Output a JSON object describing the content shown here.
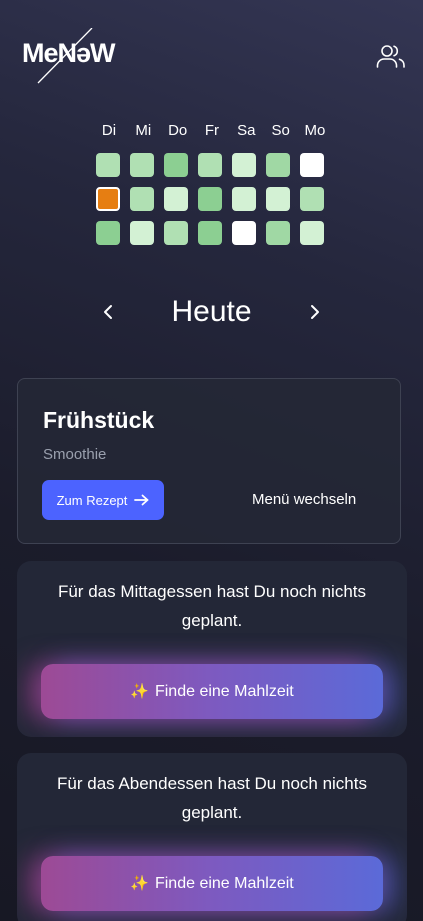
{
  "header": {
    "logo_text": "MeNəW",
    "users_icon": "users-icon"
  },
  "calendar": {
    "weekdays": [
      "Di",
      "Mi",
      "Do",
      "Fr",
      "Sa",
      "So",
      "Mo"
    ],
    "days": [
      {
        "color": "#b0e0b3",
        "selected": false
      },
      {
        "color": "#b0e0b3",
        "selected": false
      },
      {
        "color": "#8ccf92",
        "selected": false
      },
      {
        "color": "#b0e0b3",
        "selected": false
      },
      {
        "color": "#d3f1d4",
        "selected": false
      },
      {
        "color": "#a0d8a4",
        "selected": false
      },
      {
        "color": "#ffffff",
        "selected": false
      },
      {
        "color": "#e67e12",
        "selected": true
      },
      {
        "color": "#b0e0b3",
        "selected": false
      },
      {
        "color": "#d3f1d4",
        "selected": false
      },
      {
        "color": "#8ccf92",
        "selected": false
      },
      {
        "color": "#d3f1d4",
        "selected": false
      },
      {
        "color": "#d3f1d4",
        "selected": false
      },
      {
        "color": "#b0e0b3",
        "selected": false
      },
      {
        "color": "#8ccf92",
        "selected": false
      },
      {
        "color": "#d3f1d4",
        "selected": false
      },
      {
        "color": "#b0e0b3",
        "selected": false
      },
      {
        "color": "#8ccf92",
        "selected": false
      },
      {
        "color": "#ffffff",
        "selected": false
      },
      {
        "color": "#a0d8a4",
        "selected": false
      },
      {
        "color": "#d3f1d4",
        "selected": false
      }
    ]
  },
  "date_nav": {
    "label": "Heute",
    "prev_icon": "chevron-left-icon",
    "next_icon": "chevron-right-icon"
  },
  "breakfast": {
    "title": "Frühstück",
    "subtitle": "Smoothie",
    "recipe_button_label": "Zum Rezept",
    "recipe_button_icon": "arrow-right-icon",
    "change_menu_label": "Menü wechseln",
    "button_color": "#4c63ff"
  },
  "lunch": {
    "message": "Für das Mittagessen hast Du noch nichts geplant.",
    "button_label": "Finde eine Mahlzeit",
    "button_icon": "sparkles-icon"
  },
  "dinner": {
    "message": "Für das Abendessen hast Du noch nichts geplant.",
    "button_label": "Finde eine Mahlzeit",
    "button_icon": "sparkles-icon"
  },
  "colors": {
    "accent": "#4c63ff",
    "selected_day": "#e67e12",
    "gradient_start": "#9d4a95",
    "gradient_end": "#5b6ad8"
  }
}
